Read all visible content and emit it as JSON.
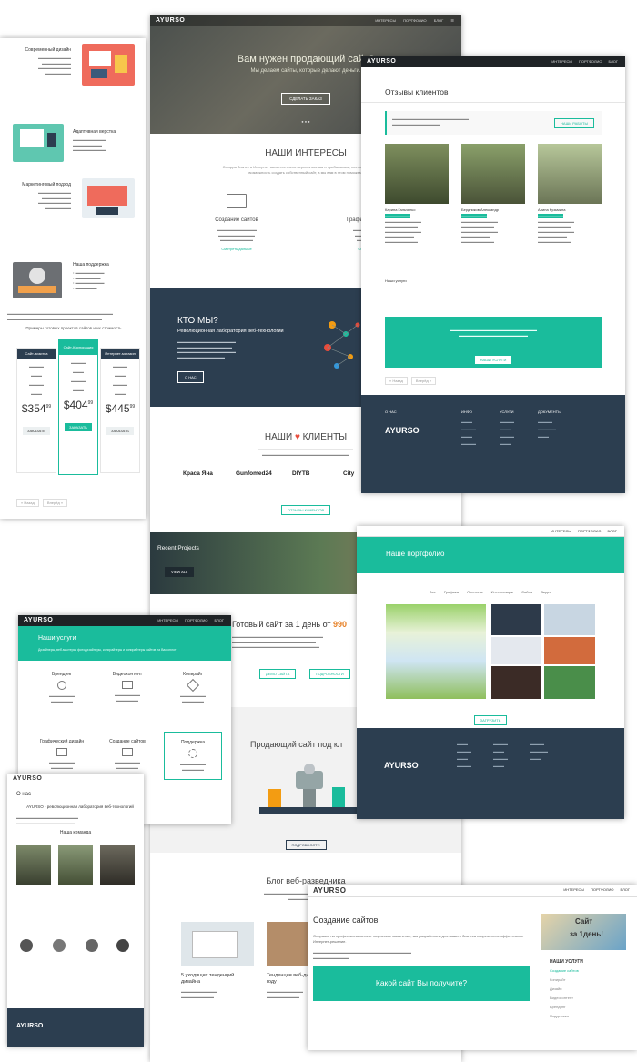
{
  "brand": {
    "logo_text": "AYURSO"
  },
  "nav": {
    "interests": "ИНТЕРЕСЫ",
    "portfolio": "ПОРТФОЛИО",
    "blog": "БЛОГ"
  },
  "left_sheet": {
    "sections": [
      {
        "title": "Современный дизайн"
      },
      {
        "title": "Адаптивная верстка"
      },
      {
        "title": "Маркетинговый подход"
      },
      {
        "title": "Наша поддержка"
      }
    ],
    "pricing_title": "Примеры готовых проектов сайтов и их стоимость",
    "plans": [
      {
        "name": "Сайт-визитка",
        "price": "354",
        "cents": "99",
        "order": "ЗАКАЗАТЬ"
      },
      {
        "name": "Сайт-Корпорация",
        "price": "404",
        "cents": "99",
        "order": "ЗАКАЗАТЬ"
      },
      {
        "name": "Интернет-магазин",
        "price": "445",
        "cents": "99",
        "order": "ЗАКАЗАТЬ"
      }
    ],
    "pager_prev": "« Назад",
    "pager_next": "Вперёд »"
  },
  "main_sheet": {
    "hero_title": "Вам нужен продающий сайт?",
    "hero_subtitle": "Мы делаем сайты, которые делают деньги.",
    "hero_button": "СДЕЛАТЬ ЗАКАЗ",
    "interests_title": "НАШИ ИНТЕРЕСЫ",
    "interests_text": "Сегодня бизнес в Интернет является очень перспективным и прибыльным, поэтому использовать возможность создать собственный сайт, а мы вам в этом поможем.",
    "cards": [
      {
        "title": "Создание сайтов",
        "link": "Смотреть дальше"
      },
      {
        "title": "Графический дизайн",
        "link": "Смотреть дальше"
      }
    ],
    "who_title": "КТО МЫ?",
    "who_subtitle": "Революционная лаборатория веб-технологий",
    "who_button": "О НАС",
    "clients_title_a": "НАШИ",
    "clients_title_b": "КЛИЕНТЫ",
    "clients_logos": [
      "Краса Яна",
      "Gunfomed24",
      "DIYTB",
      "City"
    ],
    "clients_button": "ОТЗЫВЫ КЛИЕНТОВ",
    "recent_title": "Recent Projects",
    "recent_button": "VIEW ALL",
    "day_title": "Готовый сайт за 1 день от",
    "day_price": "990",
    "demo_button": "ДЕМО САЙТА",
    "more_button": "ПОДРОБНОСТИ",
    "selling_title": "Продающий сайт под кл",
    "selling_button": "ПОДРОБНОСТИ",
    "blog_title": "Блог веб-разведчика",
    "blog_posts": [
      {
        "title": "5 уходящих тенденций дизайна"
      },
      {
        "title": "Тенденции веб-дизайна 2014 году"
      }
    ]
  },
  "reviews_sheet": {
    "title": "Отзывы клиентов",
    "cta_button": "НАШИ РАБОТЫ",
    "people": [
      {
        "name": "Карина Гальченко"
      },
      {
        "name": "Бердников Александр"
      },
      {
        "name": "Алина Кузьмина"
      }
    ],
    "services_label": "Наши услуги",
    "services_button": "НАШИ УСЛУГИ",
    "pager_prev": "« Назад",
    "pager_next": "Вперёд »",
    "footer_heads": [
      "О НАС",
      "ИНФО",
      "УСЛУГИ",
      "ДОКУМЕНТЫ"
    ]
  },
  "portfolio_sheet": {
    "title": "Наше портфолио",
    "filters": [
      "Все",
      "Графика",
      "Логотипы",
      "Интеллекции",
      "Сайты",
      "Видео"
    ],
    "more_button": "ЗАГРУЗИТЬ"
  },
  "services_sheet": {
    "title": "Наши услуги",
    "subtitle": "Дизайнеры, веб-мастеры, фотодизайнеры, копирайтеры и копирайтеры сайтов на Вас оплот",
    "items": [
      {
        "title": "Брендинг"
      },
      {
        "title": "Видеоконтент"
      },
      {
        "title": "Копирайт"
      },
      {
        "title": "Графический дизайн"
      },
      {
        "title": "Создание сайтов"
      },
      {
        "title": "Поддержка"
      }
    ]
  },
  "about_sheet": {
    "title": "О нас",
    "headline": "AYURSO - революционная лаборатория веб-технологий",
    "team_title": "Наша команда"
  },
  "create_sheet": {
    "title": "Создание сайтов",
    "text": "Опираясь на профессиональное и творческое мышление, мы разработаем для вашего бизнеса современное эффективное Интернет-решение.",
    "banner": "Какой сайт Вы получите?",
    "ad_line1": "Сайт",
    "ad_line2": "за 1день!",
    "side_title": "НАШИ УСЛУГИ",
    "side_items": [
      "Создание сайтов",
      "Копирайт",
      "Дизайн",
      "Видеоконтент",
      "Брендинг",
      "Поддержка"
    ]
  }
}
